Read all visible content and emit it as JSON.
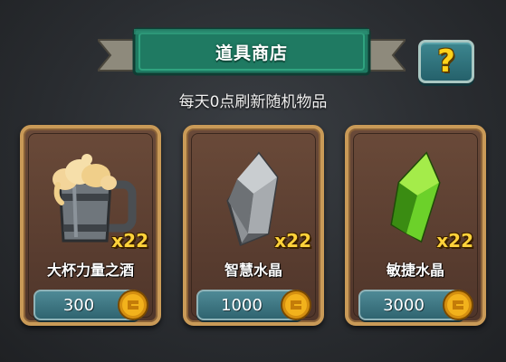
{
  "header": {
    "title": "道具商店",
    "help_label": "?"
  },
  "subtitle": "每天0点刷新随机物品",
  "items": [
    {
      "name": "大杯力量之酒",
      "quantity": "x22",
      "price": "300",
      "icon": "beer-mug-icon"
    },
    {
      "name": "智慧水晶",
      "quantity": "x22",
      "price": "1000",
      "icon": "gray-crystal-icon"
    },
    {
      "name": "敏捷水晶",
      "quantity": "x22",
      "price": "3000",
      "icon": "green-crystal-icon"
    }
  ],
  "colors": {
    "banner": "#1f7a62",
    "card_border": "#c99a57",
    "price_button": "#3f7a86",
    "coin": "#f2b21c",
    "quantity": "#ffd23a"
  }
}
